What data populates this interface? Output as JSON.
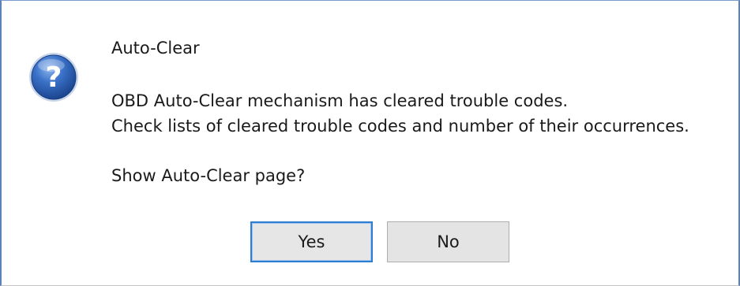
{
  "dialog": {
    "title": "Auto-Clear",
    "message_line_1": "OBD Auto-Clear mechanism has cleared trouble codes.",
    "message_line_2": "Check lists of cleared trouble codes and number of their occurrences.",
    "prompt": "Show Auto-Clear page?",
    "icon": "question-icon",
    "yes_label": "Yes",
    "no_label": "No",
    "default_button": "Yes"
  },
  "colors": {
    "frame": "#5c82b8",
    "icon_blue": "#2a5fb0",
    "default_button_border": "#2d7dd2",
    "button_face": "#e4e4e4"
  }
}
